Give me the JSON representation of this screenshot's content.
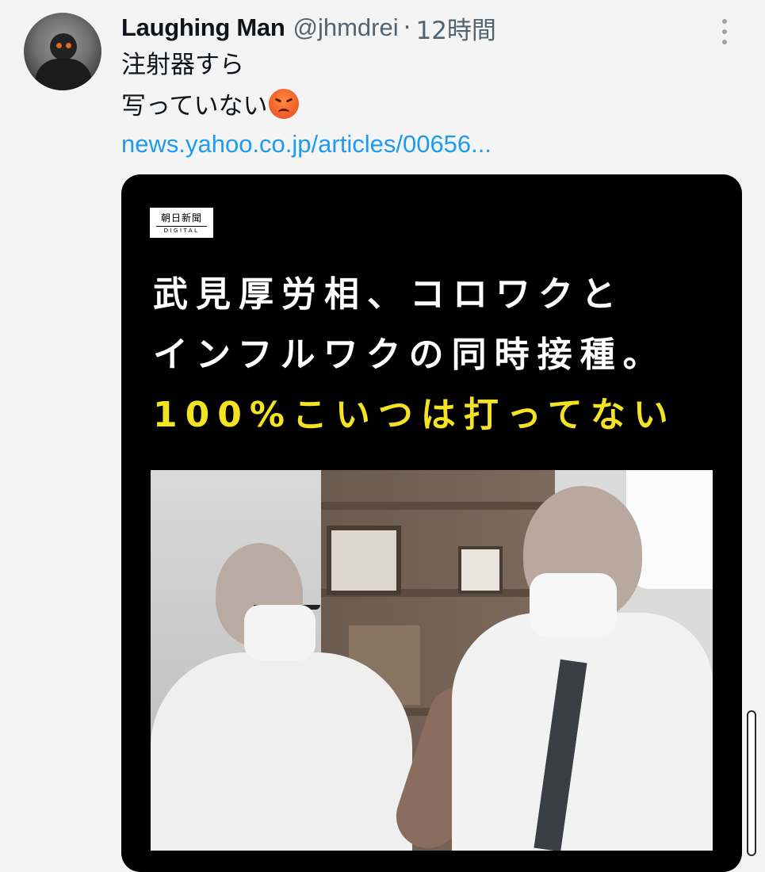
{
  "tweet": {
    "author_name": "Laughing Man",
    "author_handle": "@jhmdrei",
    "separator": "·",
    "time_ago": "12時間",
    "text_line1": "注射器すら",
    "text_line2": "写っていない",
    "emoji": "angry-face",
    "link": "news.yahoo.co.jp/articles/00656..."
  },
  "card": {
    "logo_line1": "朝日新聞",
    "logo_line2": "DIGITAL",
    "headline_line1": "武見厚労相、コロワクと",
    "headline_line2": "インフルワクの同時接種。",
    "headline_line3": "100%こいつは打ってない",
    "headline_color": "#ffffff",
    "highlight_color": "#f3e322",
    "photo_description_icon": "vaccination-photo"
  },
  "colors": {
    "link": "#1d9bf0",
    "secondary_text": "#536471",
    "background": "#f4f4f4"
  }
}
